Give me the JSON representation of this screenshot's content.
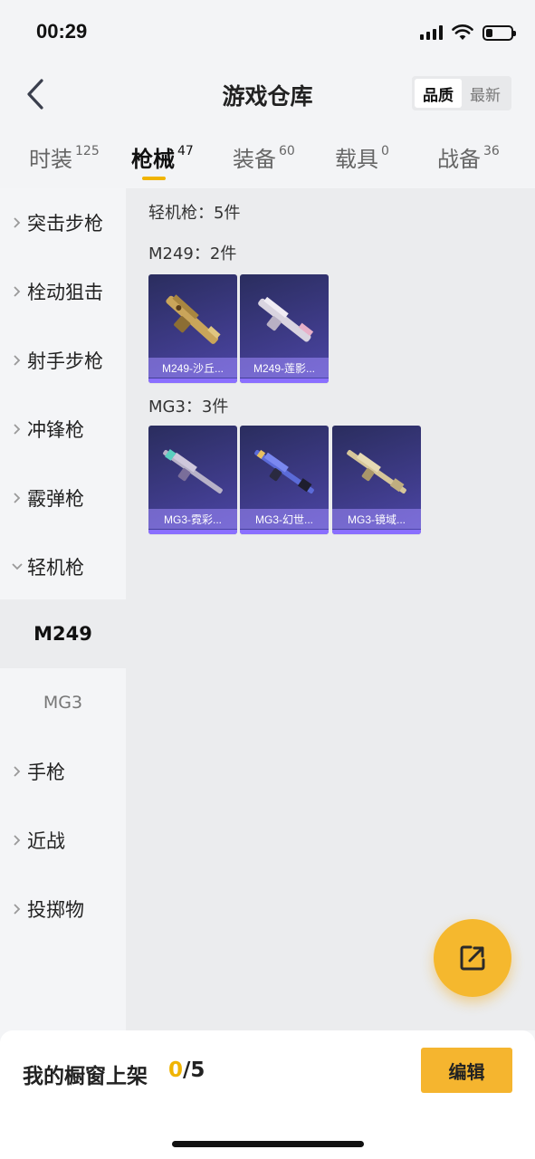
{
  "status_bar": {
    "time": "00:29",
    "battery_level": 0.25
  },
  "header": {
    "title": "游戏仓库",
    "sort_options": [
      "品质",
      "最新"
    ],
    "sort_active": "品质"
  },
  "tabs": [
    {
      "label": "时装",
      "count": "125"
    },
    {
      "label": "枪械",
      "count": "47"
    },
    {
      "label": "装备",
      "count": "60"
    },
    {
      "label": "载具",
      "count": "0"
    },
    {
      "label": "战备",
      "count": "36"
    }
  ],
  "active_tab": "枪械",
  "sidebar": {
    "items": [
      {
        "label": "突击步枪"
      },
      {
        "label": "栓动狙击"
      },
      {
        "label": "射手步枪"
      },
      {
        "label": "冲锋枪"
      },
      {
        "label": "霰弹枪"
      },
      {
        "label": "轻机枪"
      },
      {
        "label": "手枪"
      },
      {
        "label": "近战"
      },
      {
        "label": "投掷物"
      }
    ],
    "sub_items": [
      {
        "label": "M249"
      },
      {
        "label": "MG3"
      }
    ],
    "active_sub": "M249"
  },
  "content": {
    "category_total": "轻机枪：5件",
    "groups": [
      {
        "title": "M249：2件",
        "items": [
          {
            "name": "M249-沙丘...",
            "color": "#c9a55a"
          },
          {
            "name": "M249-莲影...",
            "color": "#d9d4e0"
          }
        ]
      },
      {
        "title": "MG3：3件",
        "items": [
          {
            "name": "MG3-霓彩...",
            "color": "#b8b2c8"
          },
          {
            "name": "MG3-幻世...",
            "color": "#5b6bd8"
          },
          {
            "name": "MG3-镜域...",
            "color": "#d6c69a"
          }
        ]
      }
    ]
  },
  "bottom_bar": {
    "label": "我的橱窗上架",
    "used": "0",
    "total": "/5",
    "edit_label": "编辑"
  },
  "colors": {
    "accent": "#f5b52f",
    "card_bg": "#3d3a86"
  }
}
